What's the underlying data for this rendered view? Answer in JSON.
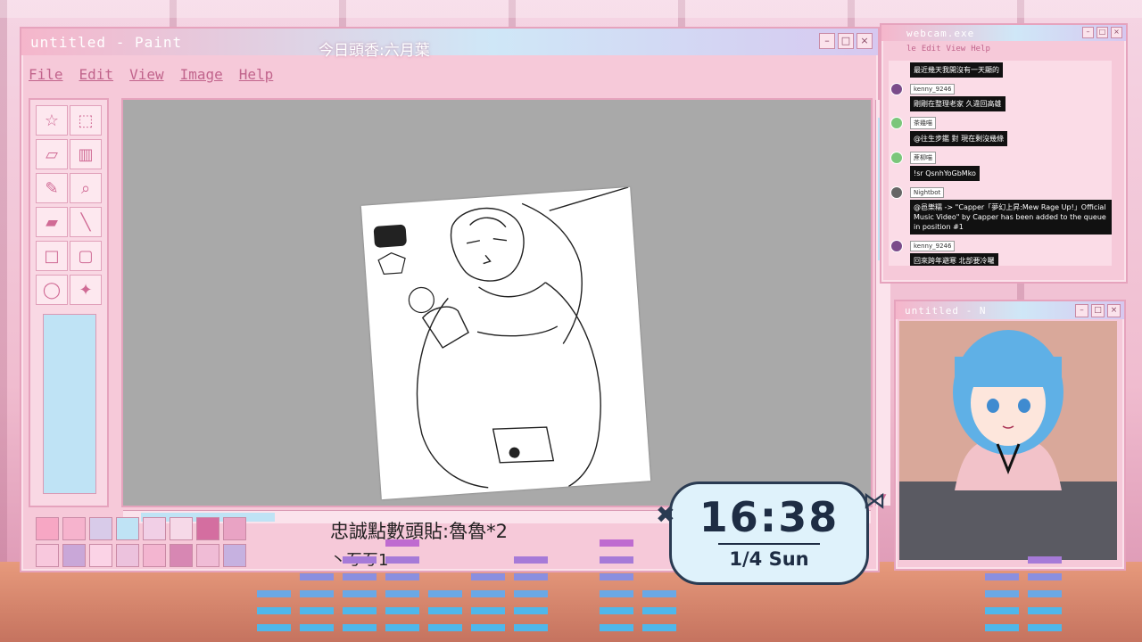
{
  "paint": {
    "title": "untitled - Paint",
    "menu": [
      "File",
      "Edit",
      "View",
      "Image",
      "Help"
    ],
    "banner": "今日頭香:六月葉"
  },
  "tools": [
    "star-select-icon",
    "select-icon",
    "eraser-icon",
    "fill-icon",
    "pencil-icon",
    "magnifier-icon",
    "eraser2-icon",
    "line-icon",
    "rectangle-icon",
    "rounded-rect-icon",
    "ellipse-icon",
    "airbrush-icon"
  ],
  "palette_colors": [
    "#f7a7c4",
    "#f6b3cd",
    "#d8cbe9",
    "#bfe3f5",
    "#f1cfe6",
    "#f6d9e8",
    "#d46ea0",
    "#e9a3c4",
    "#f8c8dd",
    "#c9a7d8",
    "#fbd3e6",
    "#ecc2dd",
    "#f3b5d0",
    "#d787b3",
    "#f0bcd6",
    "#c6b1e0"
  ],
  "loyalty": {
    "line1": "忠誠點數頭貼:魯魯*2",
    "line2": "丶ㄎㄎ1"
  },
  "chat": {
    "title": "webcam.exe",
    "menu": [
      "le",
      "Edit",
      "View",
      "Help"
    ],
    "messages": [
      {
        "name": "",
        "text": "最近幾天我開沒有一天顯的",
        "ava": "purple"
      },
      {
        "name": "kenny_9246",
        "text": "剛剛在整理老家 久違回高雄",
        "ava": "purple"
      },
      {
        "name": "茶幾喵",
        "text": "@往生步鑑 對 現在剩沒幾條",
        "ava": "green"
      },
      {
        "name": "蔗柳喵",
        "text": "!sr QsnhYoGbMko",
        "ava": "green"
      },
      {
        "name": "Nightbot",
        "text": "@邑樂糯 -> \"Capper「夢幻上昇:Mew Rage Up!」Official Music Video\" by Capper has been added to the queue in position #1",
        "ava": "gray"
      },
      {
        "name": "kenny_9246",
        "text": "回來跨年避寒 北部要冷囉",
        "ava": "purple"
      }
    ]
  },
  "cam": {
    "title": "untitled - N"
  },
  "clock": {
    "time": "16:38",
    "date": "1/4 Sun"
  },
  "colors": {
    "window_bg": "#f6c9d9",
    "titlebar_start": "#f5b6cb",
    "titlebar_mid": "#cfe7f7",
    "menu_text": "#c1648c",
    "canvas_gray": "#a9a9a9",
    "clock_text": "#1e2d44"
  }
}
